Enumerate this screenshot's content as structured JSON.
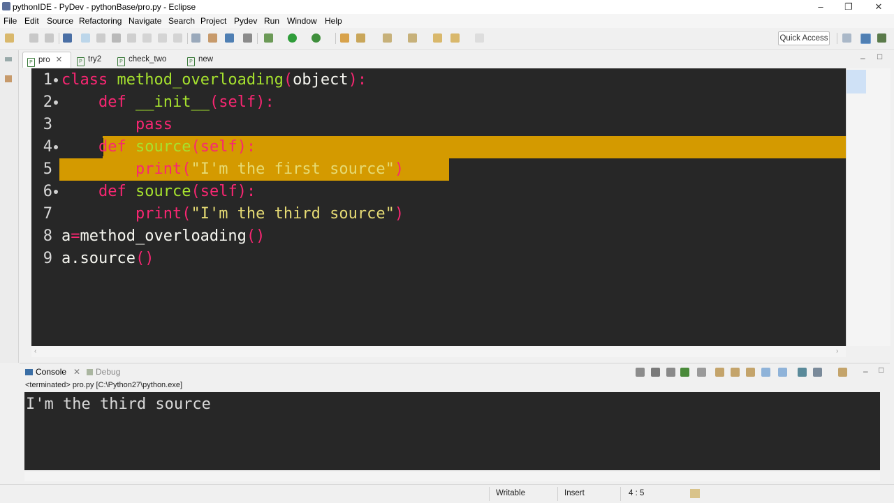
{
  "window": {
    "title": "pythonIDE - PyDev - pythonBase/pro.py - Eclipse"
  },
  "menu": [
    "File",
    "Edit",
    "Source",
    "Refactoring",
    "Navigate",
    "Search",
    "Project",
    "Pydev",
    "Run",
    "Window",
    "Help"
  ],
  "toolbar": {
    "quick_access": "Quick Access"
  },
  "editor_tabs": [
    {
      "label": "pro",
      "active": true
    },
    {
      "label": "try2",
      "active": false
    },
    {
      "label": "check_two",
      "active": false
    },
    {
      "label": "new",
      "active": false
    }
  ],
  "code": {
    "line_numbers": [
      "1",
      "2",
      "3",
      "4",
      "5",
      "6",
      "7",
      "8",
      "9"
    ],
    "lines": [
      "class method_overloading(object):",
      "    def __init__(self):",
      "        pass",
      "    def source(self):",
      "        print(\"I'm the first source\")",
      "    def source(self):",
      "        print(\"I'm the third source\")",
      "a=method_overloading()",
      "a.source()"
    ]
  },
  "console": {
    "tab_console": "Console",
    "tab_debug": "Debug",
    "terminated": "<terminated> pro.py [C:\\Python27\\python.exe]",
    "output": "I'm the third source"
  },
  "status": {
    "writable": "Writable",
    "insert": "Insert",
    "position": "4 : 5"
  },
  "colors": {
    "editor_bg": "#272727",
    "highlight": "#d49a00",
    "keyword": "#f92672",
    "function": "#a6e22e"
  }
}
